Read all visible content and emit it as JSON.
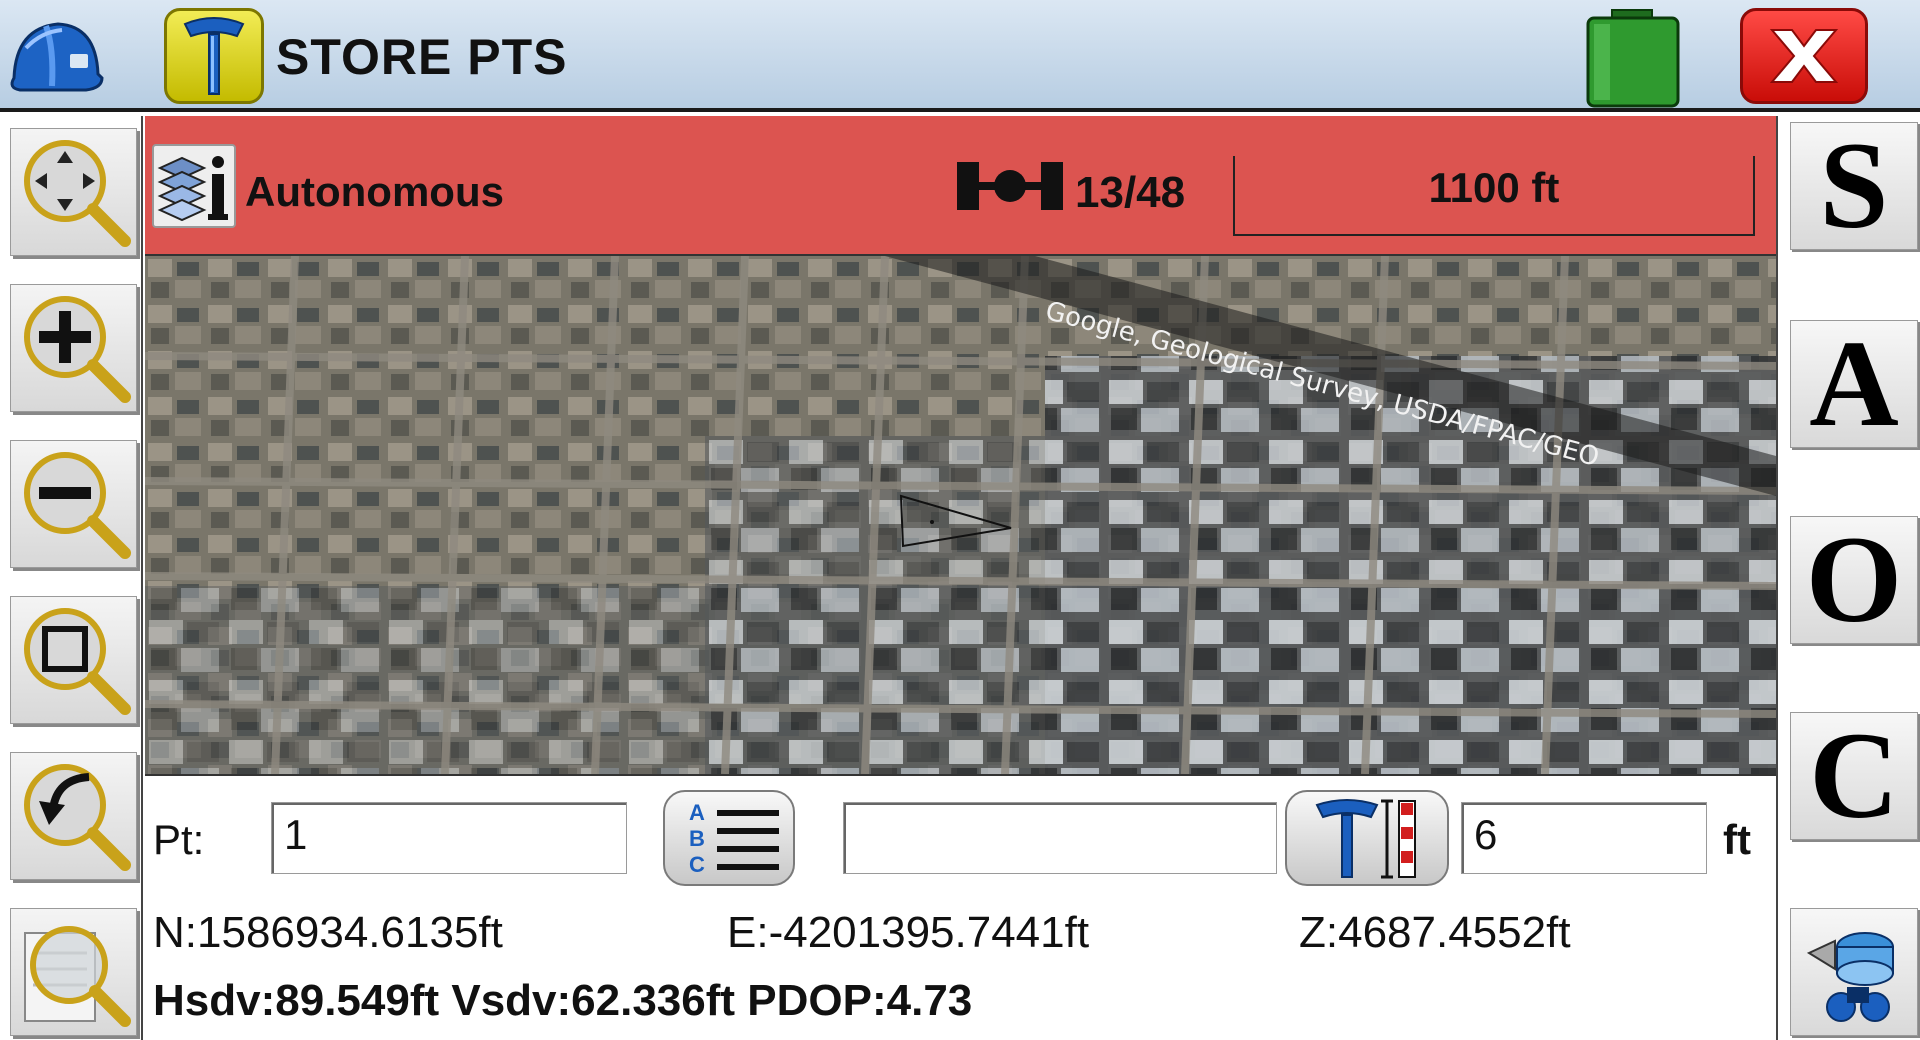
{
  "header": {
    "title": "STORE PTS"
  },
  "status": {
    "solution_mode": "Autonomous",
    "satellites": "13/48",
    "scale": "1100 ft",
    "color": "#dc5450"
  },
  "map": {
    "attribution": "Google, Geological Survey, USDA/FPAC/GEO"
  },
  "form": {
    "point_label": "Pt:",
    "point_value": "1",
    "description_value": "",
    "antenna_height_value": "6",
    "antenna_height_unit": "ft"
  },
  "readout": {
    "northing": "N:1586934.6135ft",
    "easting": "E:-4201395.7441ft",
    "elevation": "Z:4687.4552ft",
    "quality": "Hsdv:89.549ft Vsdv:62.336ft PDOP:4.73"
  },
  "right_toolbar": {
    "s_label": "S",
    "a_label": "A",
    "o_label": "O",
    "c_label": "C"
  },
  "icons": {
    "helmet": "hard-hat-icon",
    "tool": "gnss-rod-icon",
    "battery": "battery-icon",
    "close": "close-icon",
    "pan": "pan-zoom-icon",
    "zoom_in": "zoom-in-icon",
    "zoom_out": "zoom-out-icon",
    "zoom_extents": "zoom-extents-icon",
    "zoom_previous": "zoom-previous-icon",
    "zoom_list": "zoom-list-icon",
    "layers": "layers-info-icon",
    "satellite": "satellite-icon",
    "description_list": "abc-list-icon",
    "antenna_height": "antenna-height-icon",
    "survey_setup": "survey-equipment-icon"
  }
}
